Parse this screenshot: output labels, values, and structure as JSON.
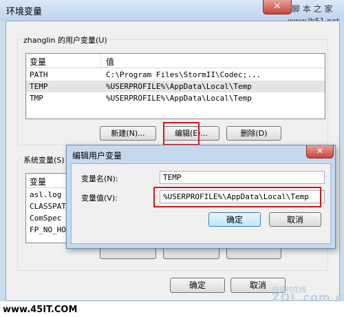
{
  "window": {
    "title": "环境变量",
    "close_glyph": "✕"
  },
  "watermark": {
    "site_cn": "脚 本 之 家",
    "site_url": "www.Jb51.net",
    "bottom_url": "www.45IT.COM",
    "logo_top": "中关村在线",
    "logo_bottom": "ZOL.com.cn"
  },
  "user_vars": {
    "label": "zhanglin 的用户变量(U)",
    "col_name": "变量",
    "col_value": "值",
    "rows": [
      {
        "name": "PATH",
        "value": "C:\\Program Files\\StormII\\Codec;..."
      },
      {
        "name": "TEMP",
        "value": "%USERPROFILE%\\AppData\\Local\\Temp"
      },
      {
        "name": "TMP",
        "value": "%USERPROFILE%\\AppData\\Local\\Temp"
      }
    ],
    "new_btn": "新建(N)...",
    "edit_btn": "编辑(E)...",
    "delete_btn": "删除(D)"
  },
  "system_vars": {
    "label": "系统变量(S)",
    "col_name": "变量",
    "rows": [
      {
        "name": "asl.log"
      },
      {
        "name": "CLASSPATH"
      },
      {
        "name": "ComSpec"
      },
      {
        "name": "FP_NO_HOST"
      }
    ]
  },
  "footer": {
    "ok_btn": "确定",
    "cancel_btn": "取消"
  },
  "edit_dialog": {
    "title": "编辑用户变量",
    "close_glyph": "✕",
    "name_label": "变量名(N):",
    "name_value": "TEMP",
    "value_label": "变量值(V):",
    "value_value": "%USERPROFILE%\\AppData\\Local\\Temp",
    "ok_btn": "确定",
    "cancel_btn": "取消"
  }
}
